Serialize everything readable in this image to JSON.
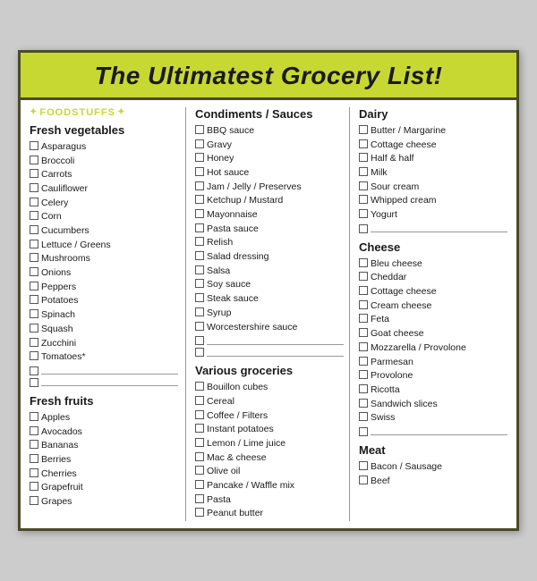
{
  "header": {
    "title": "The Ultimatest Grocery List!"
  },
  "left_column": {
    "foodstuffs_label": "FOODSTUFFS",
    "fresh_vegetables": {
      "title": "Fresh vegetables",
      "items": [
        "Asparagus",
        "Broccoli",
        "Carrots",
        "Cauliflower",
        "Celery",
        "Corn",
        "Cucumbers",
        "Lettuce / Greens",
        "Mushrooms",
        "Onions",
        "Peppers",
        "Potatoes",
        "Spinach",
        "Squash",
        "Zucchini",
        "Tomatoes*"
      ]
    },
    "fresh_fruits": {
      "title": "Fresh fruits",
      "items": [
        "Apples",
        "Avocados",
        "Bananas",
        "Berries",
        "Cherries",
        "Grapefruit",
        "Grapes"
      ]
    }
  },
  "middle_column": {
    "condiments": {
      "title": "Condiments / Sauces",
      "items": [
        "BBQ sauce",
        "Gravy",
        "Honey",
        "Hot sauce",
        "Jam / Jelly / Preserves",
        "Ketchup / Mustard",
        "Mayonnaise",
        "Pasta sauce",
        "Relish",
        "Salad dressing",
        "Salsa",
        "Soy sauce",
        "Steak sauce",
        "Syrup",
        "Worcestershire sauce"
      ]
    },
    "various": {
      "title": "Various groceries",
      "items": [
        "Bouillon cubes",
        "Cereal",
        "Coffee / Filters",
        "Instant potatoes",
        "Lemon / Lime juice",
        "Mac & cheese",
        "Olive oil",
        "Pancake / Waffle mix",
        "Pasta",
        "Peanut butter"
      ]
    }
  },
  "right_column": {
    "dairy": {
      "title": "Dairy",
      "items": [
        "Butter / Margarine",
        "Cottage cheese",
        "Half & half",
        "Milk",
        "Sour cream",
        "Whipped cream",
        "Yogurt"
      ]
    },
    "cheese": {
      "title": "Cheese",
      "items": [
        "Bleu cheese",
        "Cheddar",
        "Cottage cheese",
        "Cream cheese",
        "Feta",
        "Goat cheese",
        "Mozzarella / Provolone",
        "Parmesan",
        "Provolone",
        "Ricotta",
        "Sandwich slices",
        "Swiss"
      ]
    },
    "meat": {
      "title": "Meat",
      "items": [
        "Bacon / Sausage",
        "Beef"
      ]
    }
  }
}
